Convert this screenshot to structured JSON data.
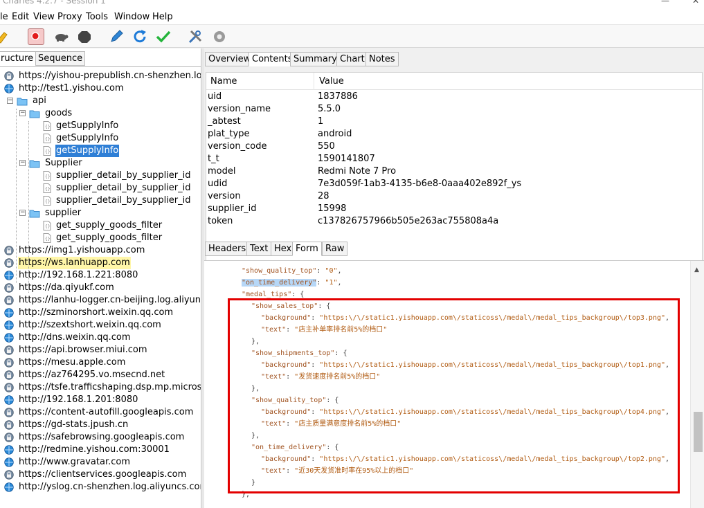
{
  "window": {
    "title": "Charles 4.2.7 - Session 1"
  },
  "menu": [
    "le",
    "Edit",
    "View",
    "Proxy",
    "Tools",
    "Window",
    "Help"
  ],
  "toolbar": [
    {
      "name": "broom-icon"
    },
    {
      "name": "record-icon"
    },
    {
      "name": "turtle-throttle-icon"
    },
    {
      "name": "breakpoints-icon"
    },
    {
      "name": "edit-pencil-icon"
    },
    {
      "name": "refresh-icon"
    },
    {
      "name": "validate-check-icon"
    },
    {
      "name": "tools-icon"
    },
    {
      "name": "settings-gear-icon"
    }
  ],
  "left_tabs": [
    "ructure",
    "Sequence"
  ],
  "tree": [
    {
      "label": "https://yishou-prepublish.cn-shenzhen.log.aliy",
      "icon": "lock-host-icon",
      "depth": 0
    },
    {
      "label": "http://test1.yishou.com",
      "icon": "globe-icon",
      "depth": 0,
      "expanded": true
    },
    {
      "label": "api",
      "icon": "folder-icon",
      "depth": 1,
      "expanded": true
    },
    {
      "label": "goods",
      "icon": "folder-icon",
      "depth": 2,
      "expanded": true
    },
    {
      "label": "getSupplyInfo",
      "icon": "json-file-icon",
      "depth": 3
    },
    {
      "label": "getSupplyInfo",
      "icon": "json-file-icon",
      "depth": 3
    },
    {
      "label": "getSupplyInfo",
      "icon": "json-file-icon",
      "depth": 3,
      "selected": true
    },
    {
      "label": "Supplier",
      "icon": "folder-icon",
      "depth": 2,
      "expanded": true
    },
    {
      "label": "supplier_detail_by_supplier_id",
      "icon": "json-file-icon",
      "depth": 3
    },
    {
      "label": "supplier_detail_by_supplier_id",
      "icon": "json-file-icon",
      "depth": 3
    },
    {
      "label": "supplier_detail_by_supplier_id",
      "icon": "json-file-icon",
      "depth": 3
    },
    {
      "label": "supplier",
      "icon": "folder-icon",
      "depth": 2,
      "expanded": true
    },
    {
      "label": "get_supply_goods_filter",
      "icon": "json-file-icon",
      "depth": 3
    },
    {
      "label": "get_supply_goods_filter",
      "icon": "json-file-icon",
      "depth": 3
    },
    {
      "label": "https://img1.yishouapp.com",
      "icon": "lock-host-icon",
      "depth": 0
    },
    {
      "label": "https://ws.lanhuapp.com",
      "icon": "lock-host-icon",
      "depth": 0,
      "highlight": true
    },
    {
      "label": "http://192.168.1.221:8080",
      "icon": "globe-icon",
      "depth": 0
    },
    {
      "label": "https://da.qiyukf.com",
      "icon": "lock-host-icon",
      "depth": 0
    },
    {
      "label": "https://lanhu-logger.cn-beijing.log.aliyuncs.cc",
      "icon": "lock-host-icon",
      "depth": 0
    },
    {
      "label": "http://szminorshort.weixin.qq.com",
      "icon": "globe-icon",
      "depth": 0
    },
    {
      "label": "http://szextshort.weixin.qq.com",
      "icon": "globe-icon",
      "depth": 0
    },
    {
      "label": "http://dns.weixin.qq.com",
      "icon": "globe-icon",
      "depth": 0
    },
    {
      "label": "https://api.browser.miui.com",
      "icon": "lock-host-icon",
      "depth": 0
    },
    {
      "label": "https://mesu.apple.com",
      "icon": "lock-host-icon",
      "depth": 0
    },
    {
      "label": "https://az764295.vo.msecnd.net",
      "icon": "lock-host-icon",
      "depth": 0
    },
    {
      "label": "https://tsfe.trafficshaping.dsp.mp.microsoft.c",
      "icon": "lock-host-icon",
      "depth": 0
    },
    {
      "label": "http://192.168.1.201:8080",
      "icon": "globe-icon",
      "depth": 0
    },
    {
      "label": "https://content-autofill.googleapis.com",
      "icon": "lock-host-icon",
      "depth": 0
    },
    {
      "label": "https://gd-stats.jpush.cn",
      "icon": "lock-host-icon",
      "depth": 0
    },
    {
      "label": "https://safebrowsing.googleapis.com",
      "icon": "lock-host-icon",
      "depth": 0
    },
    {
      "label": "http://redmine.yishou.com:30001",
      "icon": "globe-icon",
      "depth": 0
    },
    {
      "label": "http://www.gravatar.com",
      "icon": "globe-icon",
      "depth": 0
    },
    {
      "label": "https://clientservices.googleapis.com",
      "icon": "lock-host-icon",
      "depth": 0
    },
    {
      "label": "http://yslog.cn-shenzhen.log.aliyuncs.com",
      "icon": "globe-icon",
      "depth": 0
    }
  ],
  "right_tabs": [
    "Overview",
    "Contents",
    "Summary",
    "Chart",
    "Notes"
  ],
  "right_tab_active": "Contents",
  "table": {
    "headers": [
      "Name",
      "Value"
    ],
    "rows": [
      [
        "uid",
        "1837886"
      ],
      [
        "version_name",
        "5.5.0"
      ],
      [
        "_abtest",
        "1"
      ],
      [
        "plat_type",
        "android"
      ],
      [
        "version_code",
        "550"
      ],
      [
        "t_t",
        "1590141807"
      ],
      [
        "model",
        "Redmi Note 7 Pro"
      ],
      [
        "udid",
        "7e3d059f-1ab3-4135-b6e8-0aaa402e892f_ys"
      ],
      [
        "version",
        "28"
      ],
      [
        "supplier_id",
        "15998"
      ],
      [
        "token",
        "c137826757966b505e263ac755808a4a"
      ]
    ]
  },
  "bottom_tabs": [
    "Headers",
    "Text",
    "Hex",
    "Form",
    "Raw"
  ],
  "bottom_tab_active": "Form",
  "code_lines": [
    {
      "indent": 3,
      "parts": [
        [
          "key",
          "\"show_quality_top\""
        ],
        [
          "p",
          ": "
        ],
        [
          "str",
          "\"0\""
        ],
        [
          "p",
          ","
        ]
      ]
    },
    {
      "indent": 3,
      "parts": [
        [
          "hk",
          "\"on_time_delivery\""
        ],
        [
          "p",
          ": "
        ],
        [
          "str",
          "\"1\""
        ],
        [
          "p",
          ","
        ]
      ]
    },
    {
      "indent": 3,
      "parts": [
        [
          "key",
          "\"medal_tips\""
        ],
        [
          "p",
          ": {"
        ]
      ]
    },
    {
      "indent": 4,
      "parts": [
        [
          "key",
          "\"show_sales_top\""
        ],
        [
          "p",
          ": {"
        ]
      ]
    },
    {
      "indent": 5,
      "parts": [
        [
          "key",
          "\"background\""
        ],
        [
          "p",
          ": "
        ],
        [
          "str",
          "\"https:\\/\\/static1.yishouapp.com\\/staticoss\\/medal\\/medal_tips_backgroup\\/top3.png\""
        ],
        [
          "p",
          ","
        ]
      ]
    },
    {
      "indent": 5,
      "parts": [
        [
          "key",
          "\"text\""
        ],
        [
          "p",
          ": "
        ],
        [
          "str",
          "\"店主补单率排名前5%的档口\""
        ]
      ]
    },
    {
      "indent": 4,
      "parts": [
        [
          "p",
          "},"
        ]
      ]
    },
    {
      "indent": 4,
      "parts": [
        [
          "key",
          "\"show_shipments_top\""
        ],
        [
          "p",
          ": {"
        ]
      ]
    },
    {
      "indent": 5,
      "parts": [
        [
          "key",
          "\"background\""
        ],
        [
          "p",
          ": "
        ],
        [
          "str",
          "\"https:\\/\\/static1.yishouapp.com\\/staticoss\\/medal\\/medal_tips_backgroup\\/top1.png\""
        ],
        [
          "p",
          ","
        ]
      ]
    },
    {
      "indent": 5,
      "parts": [
        [
          "key",
          "\"text\""
        ],
        [
          "p",
          ": "
        ],
        [
          "str",
          "\"发货速度排名前5%的档口\""
        ]
      ]
    },
    {
      "indent": 4,
      "parts": [
        [
          "p",
          "},"
        ]
      ]
    },
    {
      "indent": 4,
      "parts": [
        [
          "key",
          "\"show_quality_top\""
        ],
        [
          "p",
          ": {"
        ]
      ]
    },
    {
      "indent": 5,
      "parts": [
        [
          "key",
          "\"background\""
        ],
        [
          "p",
          ": "
        ],
        [
          "str",
          "\"https:\\/\\/static1.yishouapp.com\\/staticoss\\/medal\\/medal_tips_backgroup\\/top4.png\""
        ],
        [
          "p",
          ","
        ]
      ]
    },
    {
      "indent": 5,
      "parts": [
        [
          "key",
          "\"text\""
        ],
        [
          "p",
          ": "
        ],
        [
          "str",
          "\"店主质量满意度排名前5%的档口\""
        ]
      ]
    },
    {
      "indent": 4,
      "parts": [
        [
          "p",
          "},"
        ]
      ]
    },
    {
      "indent": 4,
      "parts": [
        [
          "key",
          "\"on_time_delivery\""
        ],
        [
          "p",
          ": {"
        ]
      ]
    },
    {
      "indent": 5,
      "parts": [
        [
          "key",
          "\"background\""
        ],
        [
          "p",
          ": "
        ],
        [
          "str",
          "\"https:\\/\\/static1.yishouapp.com\\/staticoss\\/medal\\/medal_tips_backgroup\\/top2.png\""
        ],
        [
          "p",
          ","
        ]
      ]
    },
    {
      "indent": 5,
      "parts": [
        [
          "key",
          "\"text\""
        ],
        [
          "p",
          ": "
        ],
        [
          "str",
          "\"近30天发货准时率在95%以上的档口\""
        ]
      ]
    },
    {
      "indent": 4,
      "parts": [
        [
          "p",
          "}"
        ]
      ]
    },
    {
      "indent": 3,
      "parts": [
        [
          "p",
          "},"
        ]
      ]
    }
  ],
  "colors": {
    "selection": "#2f7fd6",
    "highlight": "#fff6a8",
    "annotation_box": "#e30000",
    "key_text": "#a0521f"
  }
}
